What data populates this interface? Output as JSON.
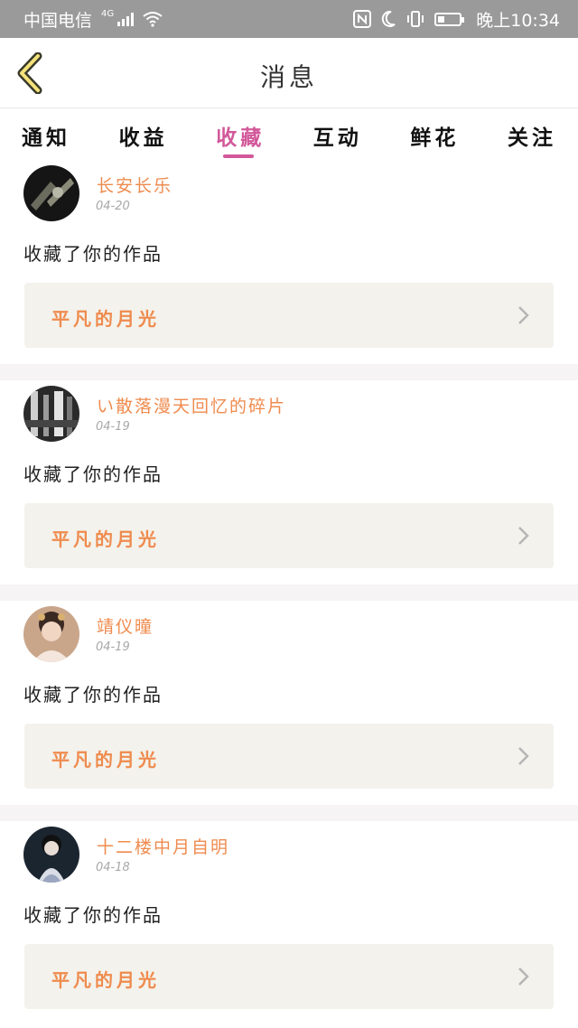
{
  "status_bar": {
    "carrier": "中国电信",
    "network": "4G",
    "time": "晚上10:34"
  },
  "header": {
    "title": "消息"
  },
  "tabs": [
    {
      "label": "通知",
      "active": false
    },
    {
      "label": "收益",
      "active": false
    },
    {
      "label": "收藏",
      "active": true
    },
    {
      "label": "互动",
      "active": false
    },
    {
      "label": "鲜花",
      "active": false
    },
    {
      "label": "关注",
      "active": false
    }
  ],
  "messages": [
    {
      "username": "长安长乐",
      "date": "04-20",
      "action": "收藏了你的作品",
      "work_title": "平凡的月光"
    },
    {
      "username": "い散落漫天回忆的碎片",
      "date": "04-19",
      "action": "收藏了你的作品",
      "work_title": "平凡的月光"
    },
    {
      "username": "靖仪曈",
      "date": "04-19",
      "action": "收藏了你的作品",
      "work_title": "平凡的月光"
    },
    {
      "username": "十二楼中月自明",
      "date": "04-18",
      "action": "收藏了你的作品",
      "work_title": "平凡的月光"
    }
  ],
  "colors": {
    "accent": "#d2589a",
    "username": "#ef8b4e",
    "status_bar_bg": "#9a9a9a",
    "work_box_bg": "#f3f2ec"
  }
}
